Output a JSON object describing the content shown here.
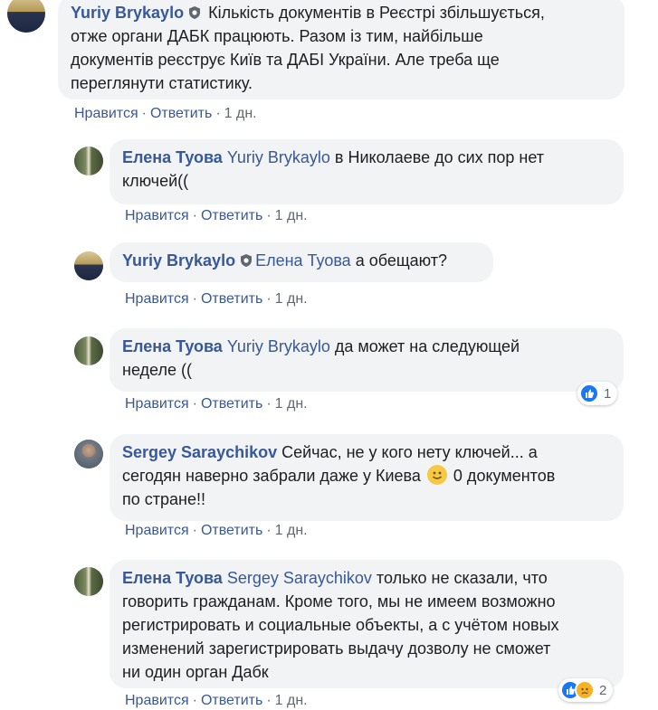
{
  "comments": [
    {
      "author": "Yuriy Brykaylo",
      "mention": "",
      "text": " Кількість документів в Реєстрі збільшується,\nотже органи ДАБК працюють. Разом із тим, найбільше\nдокументів реєструє Київ та ДАБІ України. Але треба ще\nпереглянути статистику.",
      "like": "Нравится",
      "reply": "Ответить",
      "time": "1 дн.",
      "icon": "shield-badge-icon"
    },
    {
      "author": "Елена Туова",
      "mention": "Yuriy Brykaylo",
      "text": " в Николаеве до сих пор нет\nключей((",
      "like": "Нравится",
      "reply": "Ответить",
      "time": "1 дн."
    },
    {
      "author": "Yuriy Brykaylo",
      "mention": "Елена Туова",
      "text": " а обещают?",
      "like": "Нравится",
      "reply": "Ответить",
      "time": "1 дн.",
      "icon": "shield-badge-icon"
    },
    {
      "author": "Елена Туова",
      "mention": "Yuriy Brykaylo",
      "text": " да может на следующей\nнеделе ((",
      "like": "Нравится",
      "reply": "Ответить",
      "time": "1 дн.",
      "reaction_count": "1"
    },
    {
      "author": "Sergey Saraychikov",
      "mention": "",
      "text_before_emoji": " Сейчас, не у кого нету ключей... а\nсегодян наверно забрали даже у Киева ",
      "text_after_emoji": " 0 документов\nпо стране!!",
      "emoji": "smile-emoji",
      "like": "Нравится",
      "reply": "Ответить",
      "time": "1 дн."
    },
    {
      "author": "Елена Туова",
      "mention": "Sergey Saraychikov",
      "text": " только не сказали, что\nговорить гражданам. Кроме того, мы не имеем возможно\nрегистрировать и социальные объекты, а с учётом новых\nизменений зарегистрировать выдачу дозволу не сможет\nни один орган Дабк",
      "like": "Нравится",
      "reply": "Ответить",
      "time": "1 дн.",
      "reaction_count": "2"
    }
  ],
  "separator": "·",
  "colors": {
    "link": "#385898",
    "bubble": "#f2f3f5",
    "meta": "#606770",
    "like_blue": "#1877f2",
    "sad_yellow": "#f7b125"
  }
}
